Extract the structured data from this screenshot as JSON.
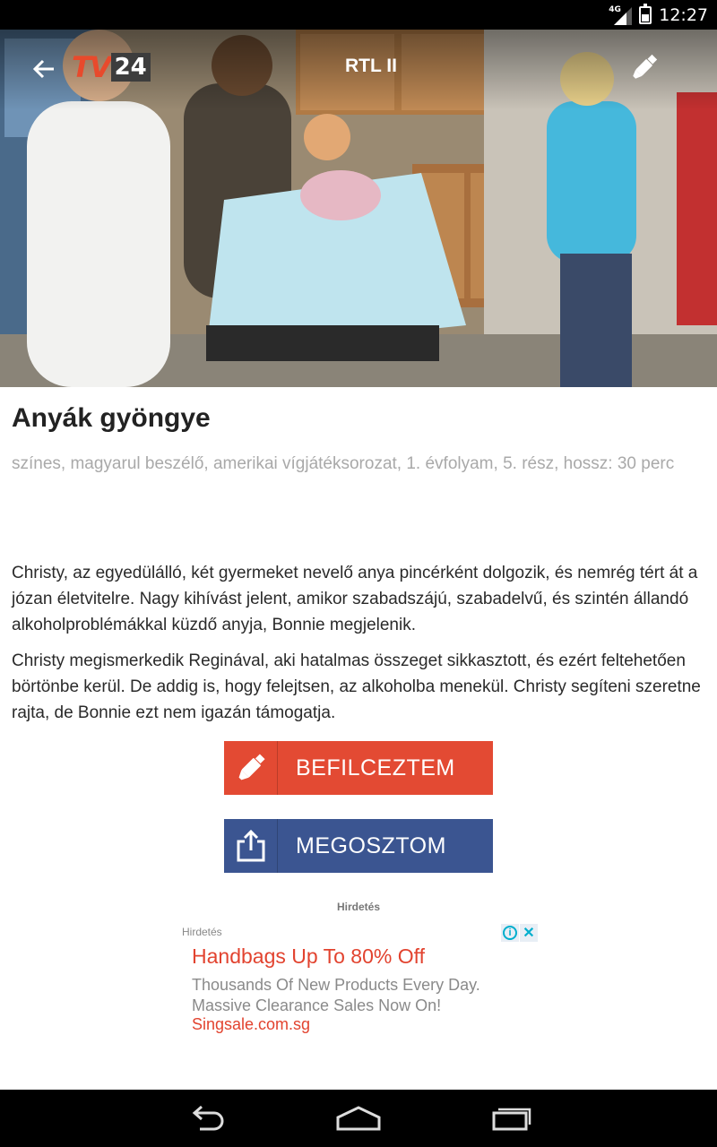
{
  "status_bar": {
    "network": "4G",
    "time": "12:27"
  },
  "header": {
    "logo_tv": "TV",
    "logo_num": "24",
    "channel": "RTL II",
    "back_icon": "arrow-left-icon",
    "edit_icon": "marker-icon"
  },
  "show": {
    "title": "Anyák gyöngye",
    "meta": "színes, magyarul beszélő, amerikai vígjátéksorozat, 1. évfolyam, 5. rész, hossz: 30 perc",
    "paragraphs": [
      "Christy, az egyedülálló, két gyermeket nevelő anya pincérként dolgozik, és nemrég tért át a józan életvitelre. Nagy kihívást jelent, amikor szabadszájú, szabadelvű, és szintén állandó alkoholproblémákkal küzdő anyja, Bonnie megjelenik.",
      "Christy megismerkedik Reginával, aki hatalmas összeget sikkasztott, és ezért feltehetően börtönbe kerül. De addig is, hogy felejtsen, az alkoholba menekül. Christy segíteni szeretne rajta, de Bonnie ezt nem igazán támogatja."
    ]
  },
  "actions": {
    "checkin_label": "BEFILCEZTEM",
    "share_label": "MEGOSZTOM",
    "colors": {
      "checkin": "#e34a33",
      "share": "#3b5591"
    }
  },
  "ad": {
    "header": "Hirdetés",
    "label": "Hirdetés",
    "headline": "Handbags Up To 80% Off",
    "body": "Thousands Of New Products Every Day. Massive Clearance Sales Now On!",
    "url": "Singsale.com.sg",
    "info_glyph": "i",
    "close_glyph": "✕"
  },
  "nav": {
    "back": "back-icon",
    "home": "home-icon",
    "recents": "recents-icon"
  }
}
